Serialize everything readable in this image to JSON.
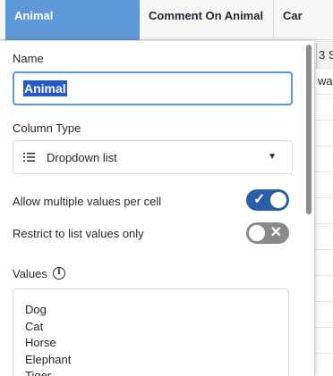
{
  "columns": {
    "animal": "Animal",
    "comment": "Comment On Animal",
    "car": "Car"
  },
  "grid_peek": {
    "cell_1": "3 S",
    "cell_2": "wag"
  },
  "panel": {
    "name_label": "Name",
    "name_value": "Animal",
    "column_type_label": "Column Type",
    "column_type_value": "Dropdown list",
    "column_type_icon": "list-icon",
    "allow_multiple_label": "Allow multiple values per cell",
    "allow_multiple_on": true,
    "restrict_label": "Restrict to list values only",
    "restrict_on": false,
    "values_label": "Values",
    "values": [
      "Dog",
      "Cat",
      "Horse",
      "Elephant",
      "Tiger"
    ]
  },
  "colors": {
    "header_active": "#5d99d9",
    "toggle_on": "#2d5da8",
    "toggle_off": "#8a8a8a",
    "selection": "#2459c7"
  }
}
